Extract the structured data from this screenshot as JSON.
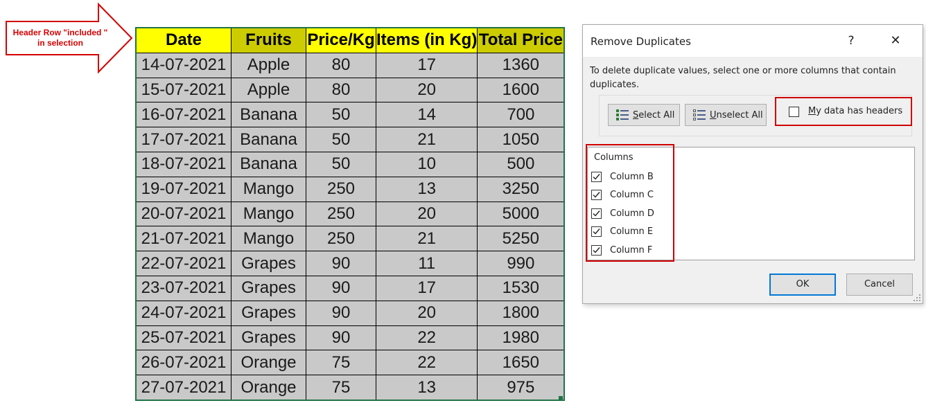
{
  "callout": {
    "line1": "Header Row \"included \"",
    "line2": "in selection"
  },
  "sheet": {
    "headers": [
      "Date",
      "Fruits",
      "Price/Kg",
      "Items (in Kg)",
      "Total Price"
    ],
    "rows": [
      [
        "14-07-2021",
        "Apple",
        "80",
        "17",
        "1360"
      ],
      [
        "15-07-2021",
        "Apple",
        "80",
        "20",
        "1600"
      ],
      [
        "16-07-2021",
        "Banana",
        "50",
        "14",
        "700"
      ],
      [
        "17-07-2021",
        "Banana",
        "50",
        "21",
        "1050"
      ],
      [
        "18-07-2021",
        "Banana",
        "50",
        "10",
        "500"
      ],
      [
        "19-07-2021",
        "Mango",
        "250",
        "13",
        "3250"
      ],
      [
        "20-07-2021",
        "Mango",
        "250",
        "20",
        "5000"
      ],
      [
        "21-07-2021",
        "Mango",
        "250",
        "21",
        "5250"
      ],
      [
        "22-07-2021",
        "Grapes",
        "90",
        "11",
        "990"
      ],
      [
        "23-07-2021",
        "Grapes",
        "90",
        "17",
        "1530"
      ],
      [
        "24-07-2021",
        "Grapes",
        "90",
        "20",
        "1800"
      ],
      [
        "25-07-2021",
        "Grapes",
        "90",
        "22",
        "1980"
      ],
      [
        "26-07-2021",
        "Orange",
        "75",
        "22",
        "1650"
      ],
      [
        "27-07-2021",
        "Orange",
        "75",
        "13",
        "975"
      ]
    ]
  },
  "dialog": {
    "title": "Remove Duplicates",
    "help": "?",
    "close": "✕",
    "instructions": "To delete duplicate values, select one or more columns that contain duplicates.",
    "select_all_u": "S",
    "select_all_rest": "elect All",
    "unselect_all_u": "U",
    "unselect_all_rest": "nselect All",
    "headers_u": "M",
    "headers_rest": "y data has headers",
    "headers_checked": false,
    "columns_label": "Columns",
    "columns": [
      {
        "label": "Column B",
        "checked": true
      },
      {
        "label": "Column C",
        "checked": true
      },
      {
        "label": "Column D",
        "checked": true
      },
      {
        "label": "Column E",
        "checked": true
      },
      {
        "label": "Column F",
        "checked": true
      }
    ],
    "ok": "OK",
    "cancel": "Cancel"
  },
  "colors": {
    "header_yellow": "#ffff00",
    "header_olive": "#cccc00",
    "cell_gray": "#c9c9c9",
    "highlight_red": "#d00000",
    "focus_blue": "#0078d7",
    "excel_green": "#217346"
  }
}
